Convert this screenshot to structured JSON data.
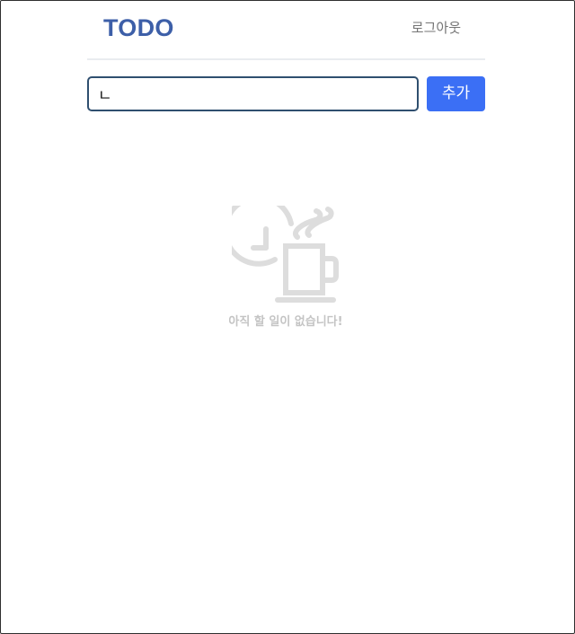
{
  "app": {
    "brand": "TODO",
    "logout_label": "로그아웃"
  },
  "form": {
    "input_value": "ㄴ",
    "add_label": "추가"
  },
  "empty_state": {
    "message": "아직 할 일이 없습니다!",
    "icon": "clock-coffee-mug-icon"
  },
  "colors": {
    "brand": "#3d5fa8",
    "accent": "#3b6ff5",
    "muted_text": "#757575",
    "empty_text": "#c4c4c4",
    "divider": "#e9ecef"
  }
}
